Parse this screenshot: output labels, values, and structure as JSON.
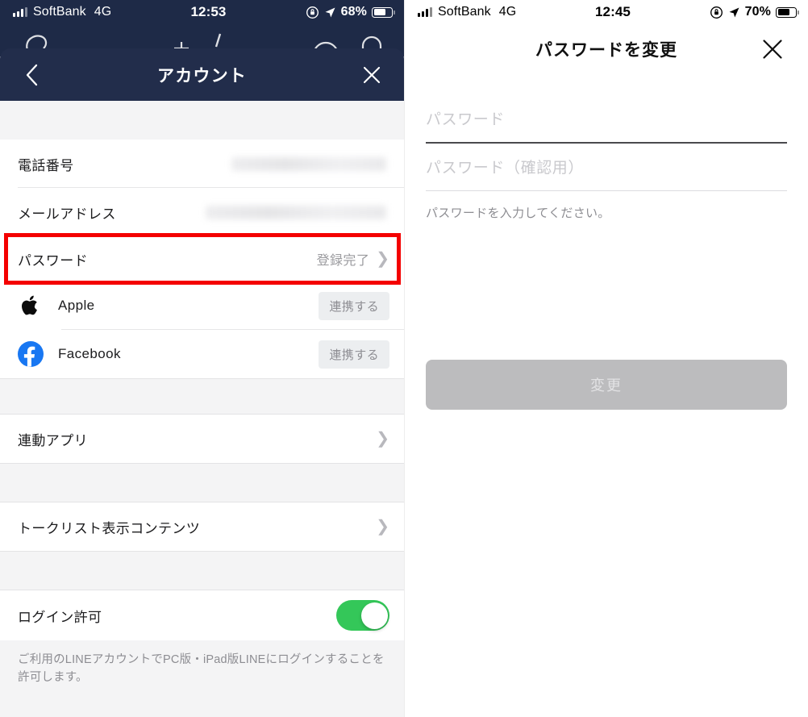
{
  "left": {
    "statusbar": {
      "carrier": "SoftBank",
      "network": "4G",
      "time": "12:53",
      "battery": "68%"
    },
    "header": {
      "title": "アカウント",
      "back_icon": "chevron-left-icon",
      "close_icon": "close-icon"
    },
    "rows": [
      {
        "label": "電話番号",
        "value": "",
        "redacted": true
      },
      {
        "label": "メールアドレス",
        "value": "",
        "redacted": true
      },
      {
        "label": "パスワード",
        "value": "登録完了",
        "highlighted": true
      }
    ],
    "social": [
      {
        "name": "Apple",
        "icon": "apple-icon",
        "action": "連携する"
      },
      {
        "name": "Facebook",
        "icon": "facebook-icon",
        "action": "連携する"
      }
    ],
    "links": [
      {
        "label": "連動アプリ"
      },
      {
        "label": "トークリスト表示コンテンツ"
      }
    ],
    "toggle_row": {
      "label": "ログイン許可",
      "state": "on"
    },
    "footnote": "ご利用のLINEアカウントでPC版・iPad版LINEにログインすることを許可します。",
    "highlight_color": "#f40000",
    "header_color": "#222d4b",
    "toggle_color": "#34c759"
  },
  "right": {
    "statusbar": {
      "carrier": "SoftBank",
      "network": "4G",
      "time": "12:45",
      "battery": "70%"
    },
    "header": {
      "title": "パスワードを変更",
      "close_icon": "close-icon"
    },
    "fields": [
      {
        "placeholder": "パスワード",
        "value": "",
        "focused": true
      },
      {
        "placeholder": "パスワード（確認用）",
        "value": "",
        "focused": false
      }
    ],
    "helper": "パスワードを入力してください。",
    "submit": {
      "label": "変更",
      "disabled": true
    }
  }
}
